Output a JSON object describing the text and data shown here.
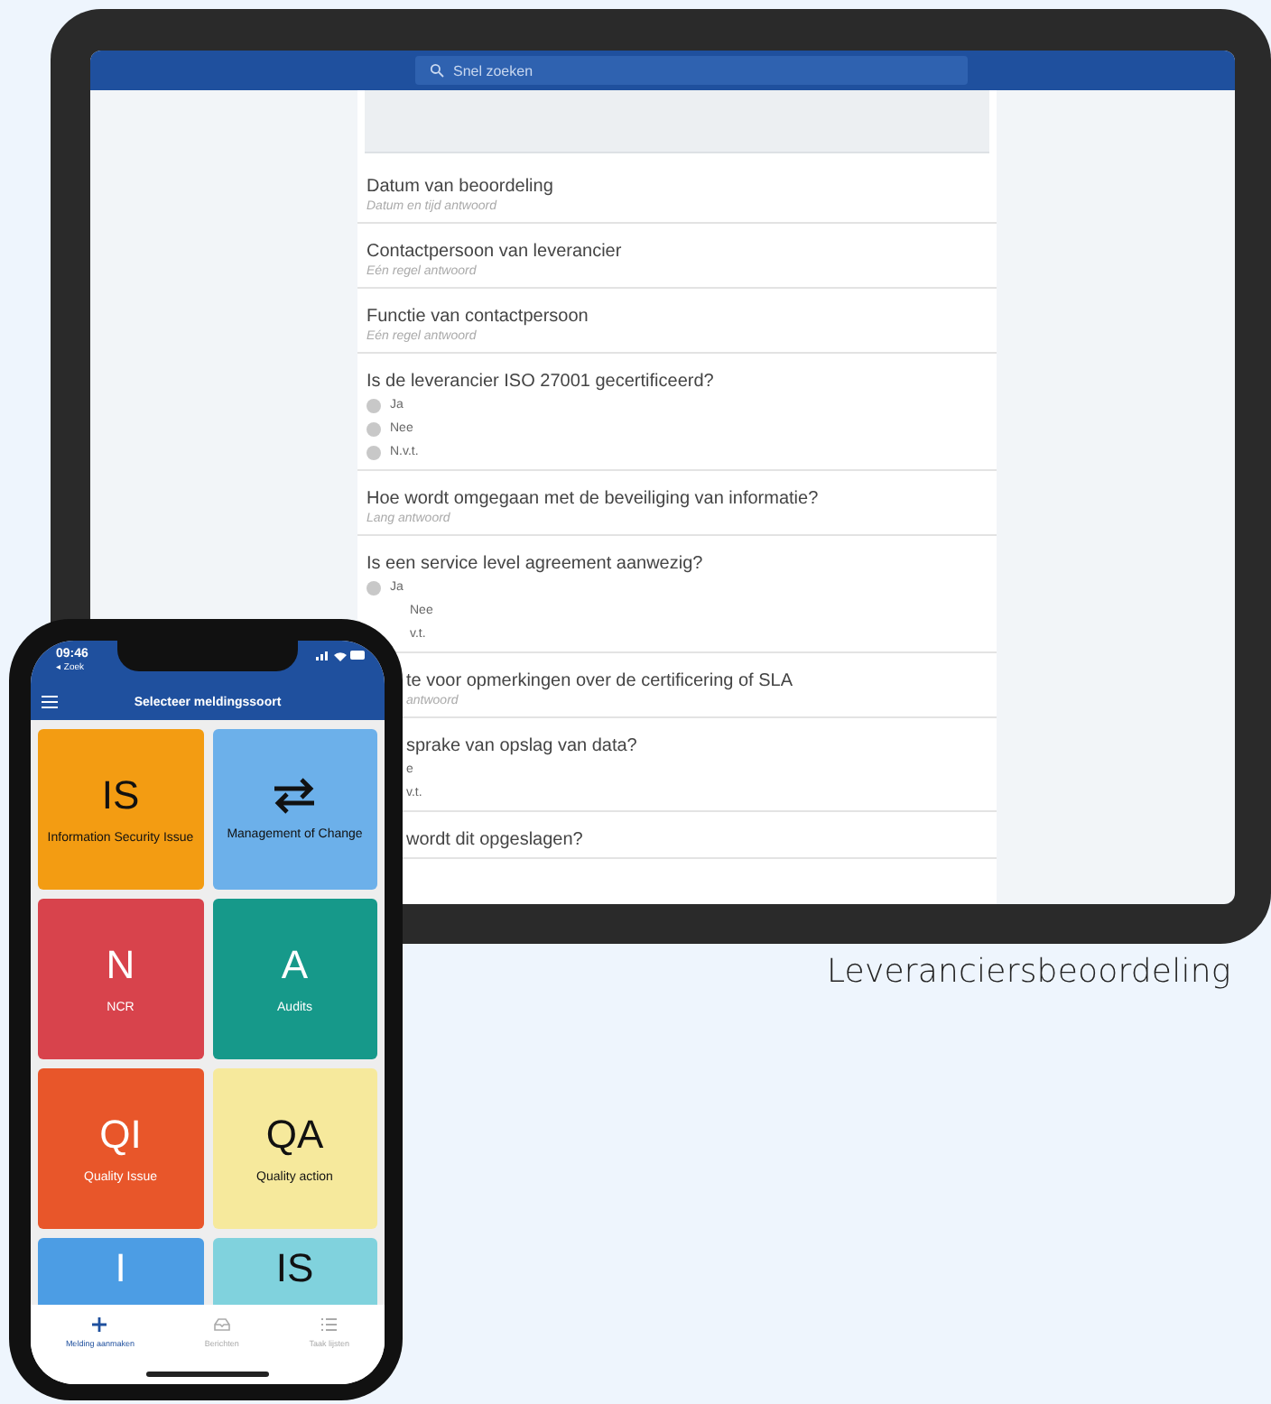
{
  "tablet": {
    "search": {
      "placeholder": "Snel zoeken"
    },
    "questions": [
      {
        "kind": "text",
        "title": "Datum van beoordeling",
        "hint": "Datum en tijd antwoord"
      },
      {
        "kind": "text",
        "title": "Contactpersoon van leverancier",
        "hint": "Eén regel antwoord"
      },
      {
        "kind": "text",
        "title": "Functie van contactpersoon",
        "hint": "Eén regel antwoord"
      },
      {
        "kind": "radio",
        "title": "Is de leverancier ISO 27001 gecertificeerd?",
        "options": [
          {
            "label": "Ja",
            "selected": false
          },
          {
            "label": "Nee",
            "selected": false
          },
          {
            "label": "N.v.t.",
            "selected": false
          }
        ]
      },
      {
        "kind": "text",
        "title": "Hoe wordt omgegaan met de beveiliging van informatie?",
        "hint": "Lang antwoord"
      },
      {
        "kind": "radio",
        "title": "Is een service level agreement aanwezig?",
        "options": [
          {
            "label": "Ja",
            "selected": false
          },
          {
            "label": "Nee",
            "selected": false
          },
          {
            "label": "v.t.",
            "selected": false
          }
        ]
      },
      {
        "kind": "text",
        "title": "te voor opmerkingen over de certificering of SLA",
        "hint": "antwoord"
      },
      {
        "kind": "radio",
        "title": "sprake van opslag van data?",
        "options": [
          {
            "label": "e",
            "selected": false
          },
          {
            "label": "v.t.",
            "selected": false
          }
        ]
      },
      {
        "kind": "text",
        "title": "wordt dit opgeslagen?"
      }
    ]
  },
  "phone": {
    "time": "09:46",
    "back": "◂ Zoek",
    "title": "Selecteer meldingssoort",
    "tiles": [
      {
        "kind": "letters",
        "symbol": "IS",
        "label": "Information Security Issue",
        "color": "#f39c12"
      },
      {
        "kind": "swap",
        "label": "Management of Change",
        "color": "#6cb0ea"
      },
      {
        "kind": "letters",
        "symbol": "N",
        "label": "NCR",
        "color": "#d8434c"
      },
      {
        "kind": "letters",
        "symbol": "A",
        "label": "Audits",
        "color": "#16998a"
      },
      {
        "kind": "letters",
        "symbol": "QI",
        "label": "Quality Issue",
        "color": "#e8562a"
      },
      {
        "kind": "letters",
        "symbol": "QA",
        "label": "Quality action",
        "color": "#f6e99c"
      },
      {
        "kind": "letters",
        "symbol": "I",
        "color": "#4c9de4"
      },
      {
        "kind": "letters",
        "symbol": "IS",
        "color": "#80d2dd"
      }
    ],
    "tabs": [
      {
        "kind": "plus",
        "label": "Melding aanmaken",
        "selected": true
      },
      {
        "kind": "inbox",
        "label": "Berichten",
        "selected": false
      },
      {
        "kind": "list",
        "label": "Taak lijsten",
        "selected": false
      }
    ]
  },
  "caption": "Leveranciersbeoordeling"
}
